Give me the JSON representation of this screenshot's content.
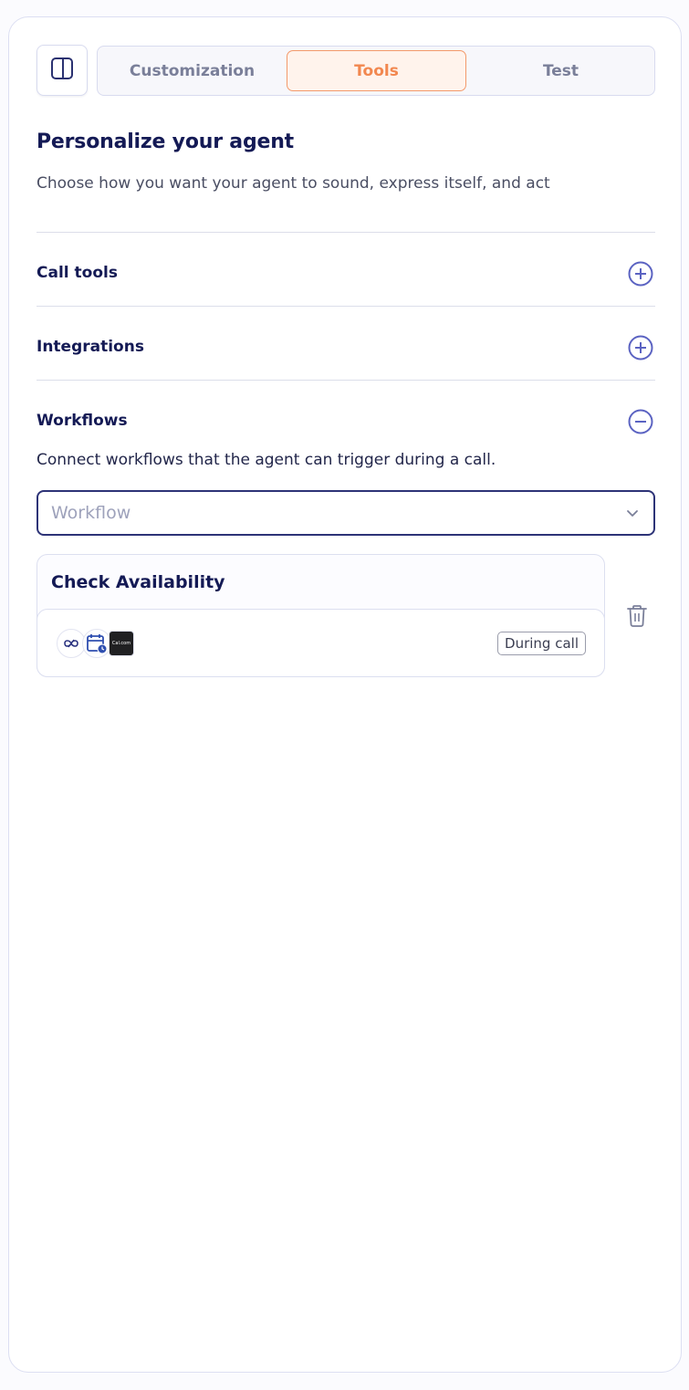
{
  "tabs": [
    {
      "label": "Customization",
      "active": false
    },
    {
      "label": "Tools",
      "active": true
    },
    {
      "label": "Test",
      "active": false
    }
  ],
  "header": {
    "title": "Personalize your agent",
    "subtitle": "Choose how you want your agent to sound, express itself, and act"
  },
  "sections": [
    {
      "title": "Call tools",
      "icon": "plus-circle-icon",
      "expanded": false
    },
    {
      "title": "Integrations",
      "icon": "plus-circle-icon",
      "expanded": false
    },
    {
      "title": "Workflows",
      "icon": "minus-circle-icon",
      "expanded": true
    }
  ],
  "workflows": {
    "description": "Connect workflows that the agent can trigger during a call.",
    "select_placeholder": "Workflow",
    "items": [
      {
        "name": "Check Availability",
        "badge": "During call",
        "icons": [
          "infinity-icon",
          "calendar-clock-icon",
          "cal-com-logo-icon"
        ],
        "logo_text": "Cal.com"
      }
    ]
  },
  "colors": {
    "accent": "#f2874f",
    "accent_bg": "#fff3ec",
    "primary": "#141a55",
    "icon": "#5b63c2"
  }
}
